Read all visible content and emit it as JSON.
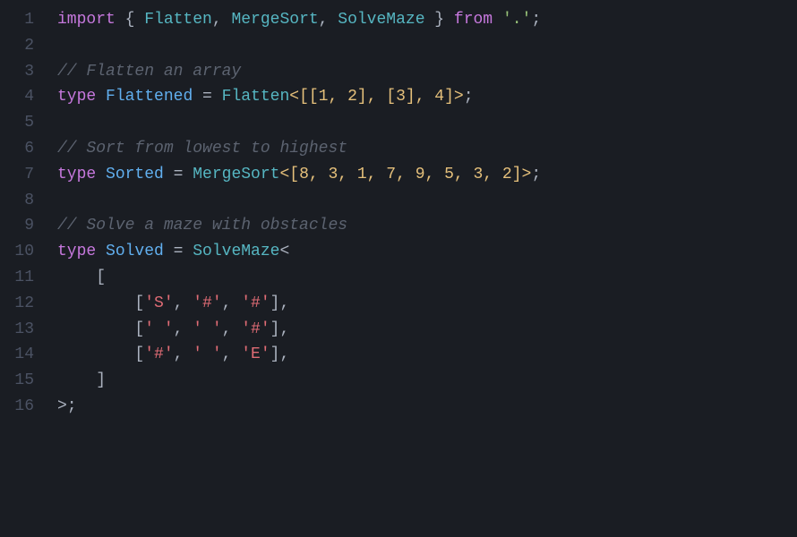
{
  "editor": {
    "background": "#1a1d23",
    "lines": [
      {
        "number": 1,
        "tokens": [
          {
            "text": "import",
            "class": "kw-import"
          },
          {
            "text": " { ",
            "class": "punctuation"
          },
          {
            "text": "Flatten",
            "class": "type-name"
          },
          {
            "text": ", ",
            "class": "punctuation"
          },
          {
            "text": "MergeSort",
            "class": "type-name"
          },
          {
            "text": ", ",
            "class": "punctuation"
          },
          {
            "text": "SolveMaze",
            "class": "type-name"
          },
          {
            "text": " } ",
            "class": "punctuation"
          },
          {
            "text": "from",
            "class": "kw-from"
          },
          {
            "text": " ",
            "class": "punctuation"
          },
          {
            "text": "'.'",
            "class": "dot-str"
          },
          {
            "text": ";",
            "class": "punctuation"
          }
        ]
      },
      {
        "number": 2,
        "tokens": []
      },
      {
        "number": 3,
        "tokens": [
          {
            "text": "// Flatten an array",
            "class": "comment"
          }
        ]
      },
      {
        "number": 4,
        "tokens": [
          {
            "text": "type",
            "class": "kw-type"
          },
          {
            "text": " ",
            "class": "punctuation"
          },
          {
            "text": "Flattened",
            "class": "identifier"
          },
          {
            "text": " = ",
            "class": "operator"
          },
          {
            "text": "Flatten",
            "class": "type-name"
          },
          {
            "text": "<[[1, 2], [3], 4]>",
            "class": "number"
          },
          {
            "text": ";",
            "class": "punctuation"
          }
        ]
      },
      {
        "number": 5,
        "tokens": []
      },
      {
        "number": 6,
        "tokens": [
          {
            "text": "// Sort from lowest to highest",
            "class": "comment"
          }
        ]
      },
      {
        "number": 7,
        "tokens": [
          {
            "text": "type",
            "class": "kw-type"
          },
          {
            "text": " ",
            "class": "punctuation"
          },
          {
            "text": "Sorted",
            "class": "identifier"
          },
          {
            "text": " = ",
            "class": "operator"
          },
          {
            "text": "MergeSort",
            "class": "type-name"
          },
          {
            "text": "<[8, 3, 1, 7, 9, 5, 3, 2]>",
            "class": "number"
          },
          {
            "text": ";",
            "class": "punctuation"
          }
        ]
      },
      {
        "number": 8,
        "tokens": []
      },
      {
        "number": 9,
        "tokens": [
          {
            "text": "// Solve a maze with obstacles",
            "class": "comment"
          }
        ]
      },
      {
        "number": 10,
        "tokens": [
          {
            "text": "type",
            "class": "kw-type"
          },
          {
            "text": " ",
            "class": "punctuation"
          },
          {
            "text": "Solved",
            "class": "identifier"
          },
          {
            "text": " = ",
            "class": "operator"
          },
          {
            "text": "SolveMaze",
            "class": "type-name"
          },
          {
            "text": "<",
            "class": "punctuation"
          }
        ]
      },
      {
        "number": 11,
        "tokens": [
          {
            "text": "    [",
            "class": "punctuation"
          }
        ]
      },
      {
        "number": 12,
        "tokens": [
          {
            "text": "        [",
            "class": "punctuation"
          },
          {
            "text": "'S'",
            "class": "char-str"
          },
          {
            "text": ", ",
            "class": "punctuation"
          },
          {
            "text": "'#'",
            "class": "char-str"
          },
          {
            "text": ", ",
            "class": "punctuation"
          },
          {
            "text": "'#'",
            "class": "char-str"
          },
          {
            "text": "],",
            "class": "punctuation"
          }
        ]
      },
      {
        "number": 13,
        "tokens": [
          {
            "text": "        [",
            "class": "punctuation"
          },
          {
            "text": "' '",
            "class": "char-str"
          },
          {
            "text": ", ",
            "class": "punctuation"
          },
          {
            "text": "' '",
            "class": "char-str"
          },
          {
            "text": ", ",
            "class": "punctuation"
          },
          {
            "text": "'#'",
            "class": "char-str"
          },
          {
            "text": "],",
            "class": "punctuation"
          }
        ]
      },
      {
        "number": 14,
        "tokens": [
          {
            "text": "        [",
            "class": "punctuation"
          },
          {
            "text": "'#'",
            "class": "char-str"
          },
          {
            "text": ", ",
            "class": "punctuation"
          },
          {
            "text": "' '",
            "class": "char-str"
          },
          {
            "text": ", ",
            "class": "punctuation"
          },
          {
            "text": "'E'",
            "class": "char-str"
          },
          {
            "text": "],",
            "class": "punctuation"
          }
        ]
      },
      {
        "number": 15,
        "tokens": [
          {
            "text": "    ]",
            "class": "punctuation"
          }
        ]
      },
      {
        "number": 16,
        "tokens": [
          {
            "text": ">;",
            "class": "punctuation"
          }
        ]
      }
    ]
  }
}
